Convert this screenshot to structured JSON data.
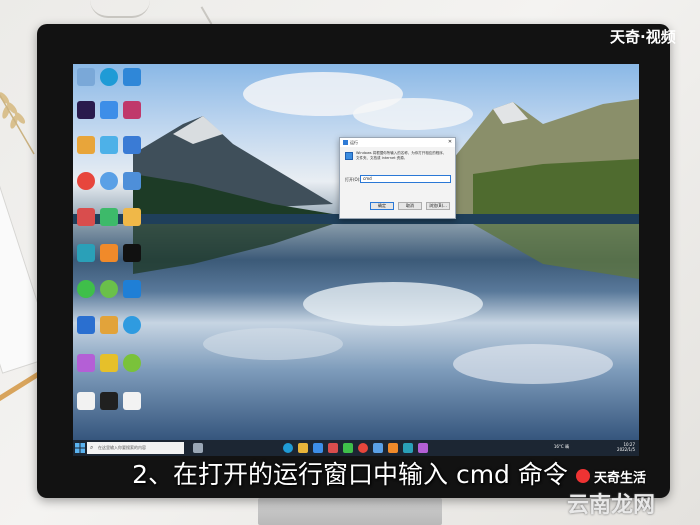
{
  "watermark_top": "天奇·视频",
  "subtitle": "2、在打开的运行窗口中输入 cmd 命令",
  "watermark_logo": "天奇生活",
  "watermark_site": "云南龙网",
  "run_dialog": {
    "title": "运行",
    "close_icon": "close-icon",
    "description": "Windows 将根据你所输入的名称，为你打开相应的程序、文件夹、文档或 Internet 资源。",
    "open_label": "打开(O):",
    "input_value": "cmd",
    "buttons": [
      "确定",
      "取消",
      "浏览(B)..."
    ]
  },
  "taskbar": {
    "search_placeholder": "在这里输入你要搜索的内容",
    "tray_text": "16°C 晴",
    "time": "10:27",
    "date": "2022/1/5"
  },
  "colors": {
    "taskbar": "#1c2633",
    "dialog_accent": "#2a78d6",
    "monitor": "#121212"
  }
}
